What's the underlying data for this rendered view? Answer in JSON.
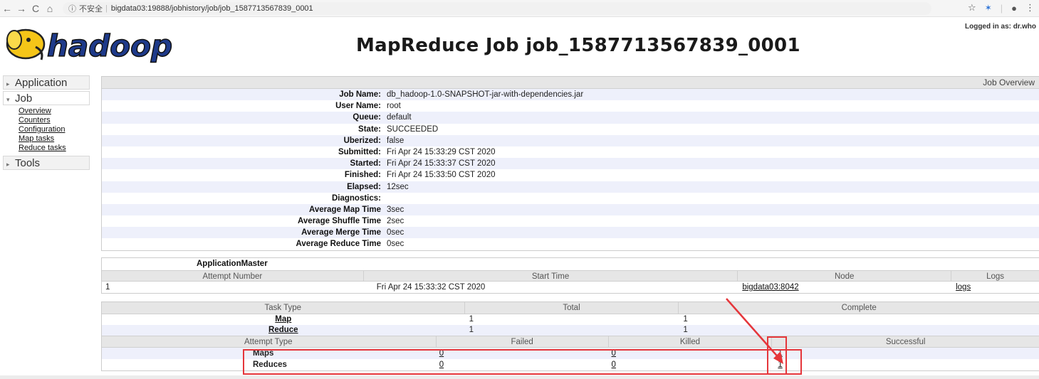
{
  "browser": {
    "back": "←",
    "forward": "→",
    "reload": "C",
    "home": "⌂",
    "info": "ⓘ",
    "insecure_label": "不安全",
    "url": "bigdata03:19888/jobhistory/job/job_1587713567839_0001"
  },
  "header": {
    "logged_in": "Logged in as: dr.who",
    "title": "MapReduce Job job_1587713567839_0001",
    "logo_text": "hadoop"
  },
  "sidebar": {
    "sections": [
      {
        "label": "Application"
      },
      {
        "label": "Job"
      },
      {
        "label": "Tools"
      }
    ],
    "job_links": [
      "Overview",
      "Counters",
      "Configuration",
      "Map tasks",
      "Reduce tasks"
    ]
  },
  "overview": {
    "heading": "Job Overview",
    "rows": [
      {
        "key": "Job Name:",
        "value": "db_hadoop-1.0-SNAPSHOT-jar-with-dependencies.jar"
      },
      {
        "key": "User Name:",
        "value": "root"
      },
      {
        "key": "Queue:",
        "value": "default"
      },
      {
        "key": "State:",
        "value": "SUCCEEDED"
      },
      {
        "key": "Uberized:",
        "value": "false"
      },
      {
        "key": "Submitted:",
        "value": "Fri Apr 24 15:33:29 CST 2020"
      },
      {
        "key": "Started:",
        "value": "Fri Apr 24 15:33:37 CST 2020"
      },
      {
        "key": "Finished:",
        "value": "Fri Apr 24 15:33:50 CST 2020"
      },
      {
        "key": "Elapsed:",
        "value": "12sec"
      },
      {
        "key": "Diagnostics:",
        "value": ""
      },
      {
        "key": "Average Map Time",
        "value": "3sec"
      },
      {
        "key": "Average Shuffle Time",
        "value": "2sec"
      },
      {
        "key": "Average Merge Time",
        "value": "0sec"
      },
      {
        "key": "Average Reduce Time",
        "value": "0sec"
      }
    ]
  },
  "app_master": {
    "title": "ApplicationMaster",
    "headers": {
      "attempt": "Attempt Number",
      "start": "Start Time",
      "node": "Node",
      "logs": "Logs"
    },
    "row": {
      "attempt": "1",
      "start": "Fri Apr 24 15:33:32 CST 2020",
      "node": "bigdata03:8042",
      "logs": "logs"
    }
  },
  "tasks": {
    "headers": {
      "type": "Task Type",
      "total": "Total",
      "complete": "Complete"
    },
    "rows": [
      {
        "type": "Map",
        "total": "1",
        "complete": "1"
      },
      {
        "type": "Reduce",
        "total": "1",
        "complete": "1"
      }
    ]
  },
  "attempts": {
    "headers": {
      "type": "Attempt Type",
      "failed": "Failed",
      "killed": "Killed",
      "successful": "Successful"
    },
    "rows": [
      {
        "type": "Maps",
        "failed": "0",
        "killed": "0",
        "successful": "1"
      },
      {
        "type": "Reduces",
        "failed": "0",
        "killed": "0",
        "successful": "1"
      }
    ]
  },
  "colors": {
    "annotation": "#e5363b",
    "row_stripe": "#eef0fb",
    "header_bg": "#e6e6e6"
  }
}
